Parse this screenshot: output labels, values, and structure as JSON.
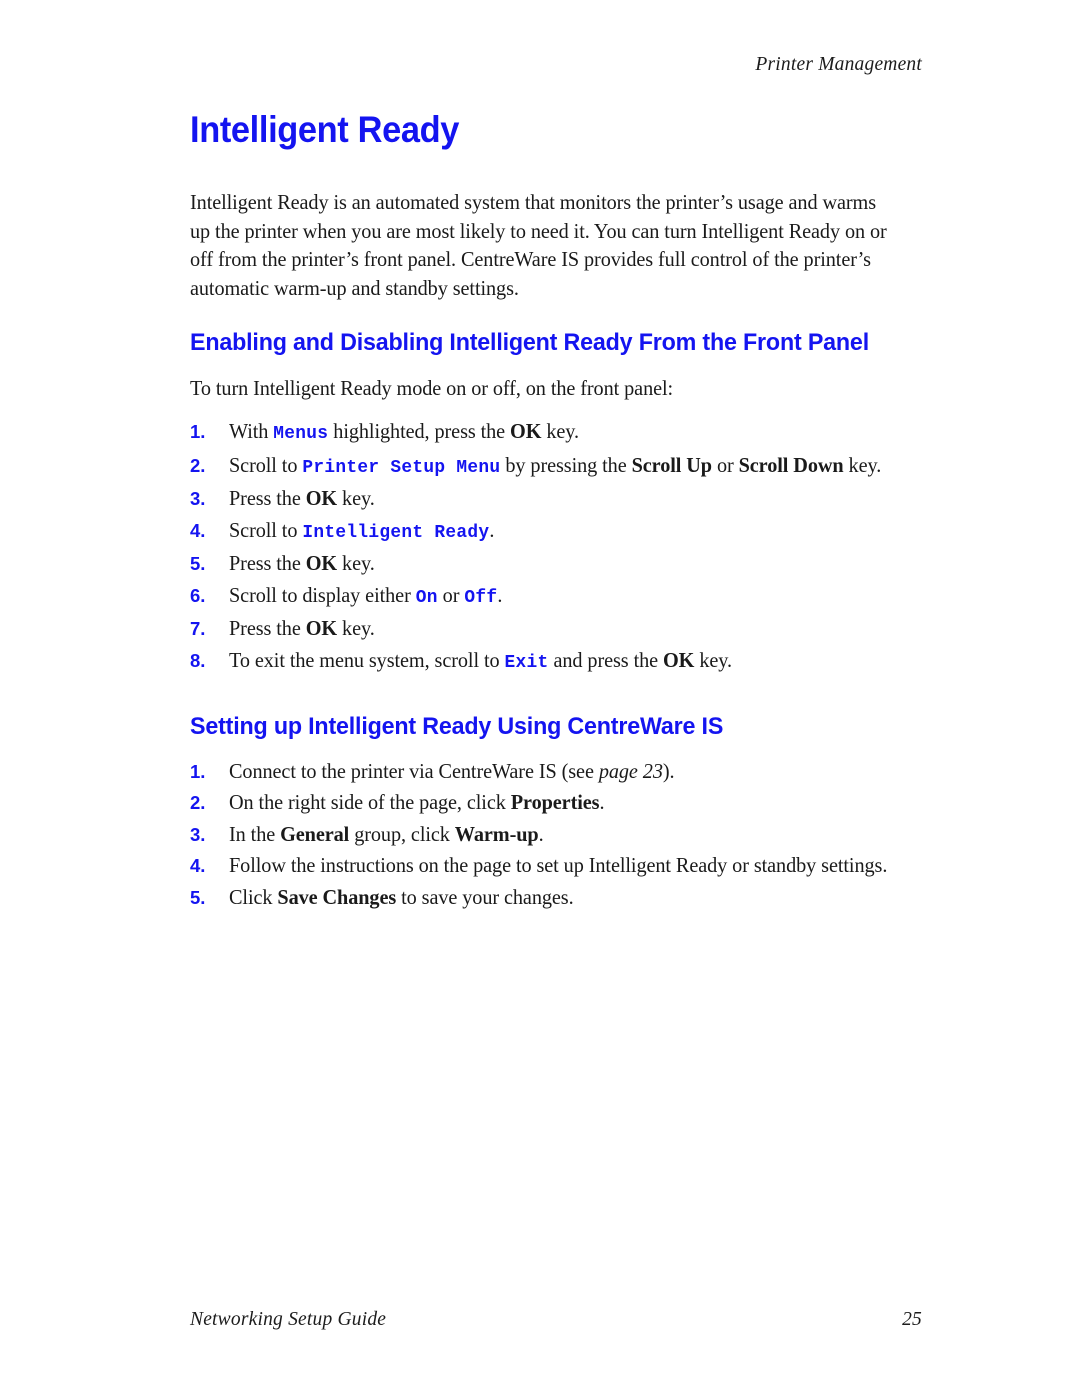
{
  "header": {
    "running_head": "Printer Management"
  },
  "colors": {
    "heading_blue": "#1414f0",
    "body_black": "#1a1a1a"
  },
  "main": {
    "title": "Intelligent Ready",
    "intro_paragraph": "Intelligent Ready is an automated system that monitors the printer’s usage and warms up the printer when you are most likely to need it. You can turn Intelligent Ready on or off from the printer’s front panel. CentreWare IS provides full control of the printer’s automatic warm-up and standby settings.",
    "sections": [
      {
        "heading": "Enabling and Disabling Intelligent Ready From the Front Panel",
        "lead_in": "To turn Intelligent Ready mode on or off, on the front panel:",
        "steps": [
          {
            "num": "1.",
            "parts": [
              {
                "type": "text",
                "text": "With "
              },
              {
                "type": "mono",
                "text": "Menus"
              },
              {
                "type": "text",
                "text": " highlighted, press the "
              },
              {
                "type": "bold",
                "text": "OK"
              },
              {
                "type": "text",
                "text": " key."
              }
            ]
          },
          {
            "num": "2.",
            "parts": [
              {
                "type": "text",
                "text": "Scroll to "
              },
              {
                "type": "mono",
                "text": "Printer Setup Menu"
              },
              {
                "type": "text",
                "text": " by pressing the "
              },
              {
                "type": "bold",
                "text": "Scroll Up"
              },
              {
                "type": "text",
                "text": " or "
              },
              {
                "type": "bold",
                "text": "Scroll Down"
              },
              {
                "type": "text",
                "text": " key."
              }
            ]
          },
          {
            "num": "3.",
            "parts": [
              {
                "type": "text",
                "text": "Press the "
              },
              {
                "type": "bold",
                "text": "OK"
              },
              {
                "type": "text",
                "text": " key."
              }
            ]
          },
          {
            "num": "4.",
            "parts": [
              {
                "type": "text",
                "text": "Scroll to "
              },
              {
                "type": "mono",
                "text": "Intelligent Ready"
              },
              {
                "type": "text",
                "text": "."
              }
            ]
          },
          {
            "num": "5.",
            "parts": [
              {
                "type": "text",
                "text": "Press the "
              },
              {
                "type": "bold",
                "text": "OK"
              },
              {
                "type": "text",
                "text": " key."
              }
            ]
          },
          {
            "num": "6.",
            "parts": [
              {
                "type": "text",
                "text": "Scroll to display either "
              },
              {
                "type": "mono",
                "text": "On"
              },
              {
                "type": "text",
                "text": " or "
              },
              {
                "type": "mono",
                "text": "Off"
              },
              {
                "type": "text",
                "text": "."
              }
            ]
          },
          {
            "num": "7.",
            "parts": [
              {
                "type": "text",
                "text": "Press the "
              },
              {
                "type": "bold",
                "text": "OK"
              },
              {
                "type": "text",
                "text": " key."
              }
            ]
          },
          {
            "num": "8.",
            "parts": [
              {
                "type": "text",
                "text": "To exit the menu system, scroll to "
              },
              {
                "type": "mono",
                "text": "Exit"
              },
              {
                "type": "text",
                "text": " and press the "
              },
              {
                "type": "bold",
                "text": "OK"
              },
              {
                "type": "text",
                "text": " key."
              }
            ]
          }
        ]
      },
      {
        "heading": "Setting up Intelligent Ready Using CentreWare IS",
        "lead_in": "",
        "steps": [
          {
            "num": "1.",
            "parts": [
              {
                "type": "text",
                "text": "Connect to the printer via CentreWare IS (see "
              },
              {
                "type": "xref",
                "text": "page 23"
              },
              {
                "type": "text",
                "text": ")."
              }
            ]
          },
          {
            "num": "2.",
            "parts": [
              {
                "type": "text",
                "text": "On the right side of the page, click "
              },
              {
                "type": "bold",
                "text": "Properties"
              },
              {
                "type": "text",
                "text": "."
              }
            ]
          },
          {
            "num": "3.",
            "parts": [
              {
                "type": "text",
                "text": "In the "
              },
              {
                "type": "bold",
                "text": "General"
              },
              {
                "type": "text",
                "text": " group, click "
              },
              {
                "type": "bold",
                "text": "Warm-up"
              },
              {
                "type": "text",
                "text": "."
              }
            ]
          },
          {
            "num": "4.",
            "parts": [
              {
                "type": "text",
                "text": "Follow the instructions on the page to set up Intelligent Ready or standby settings."
              }
            ]
          },
          {
            "num": "5.",
            "parts": [
              {
                "type": "text",
                "text": "Click "
              },
              {
                "type": "bold",
                "text": "Save Changes"
              },
              {
                "type": "text",
                "text": " to save your changes."
              }
            ]
          }
        ]
      }
    ]
  },
  "footer": {
    "guide_title": "Networking Setup Guide",
    "page_number": "25"
  }
}
